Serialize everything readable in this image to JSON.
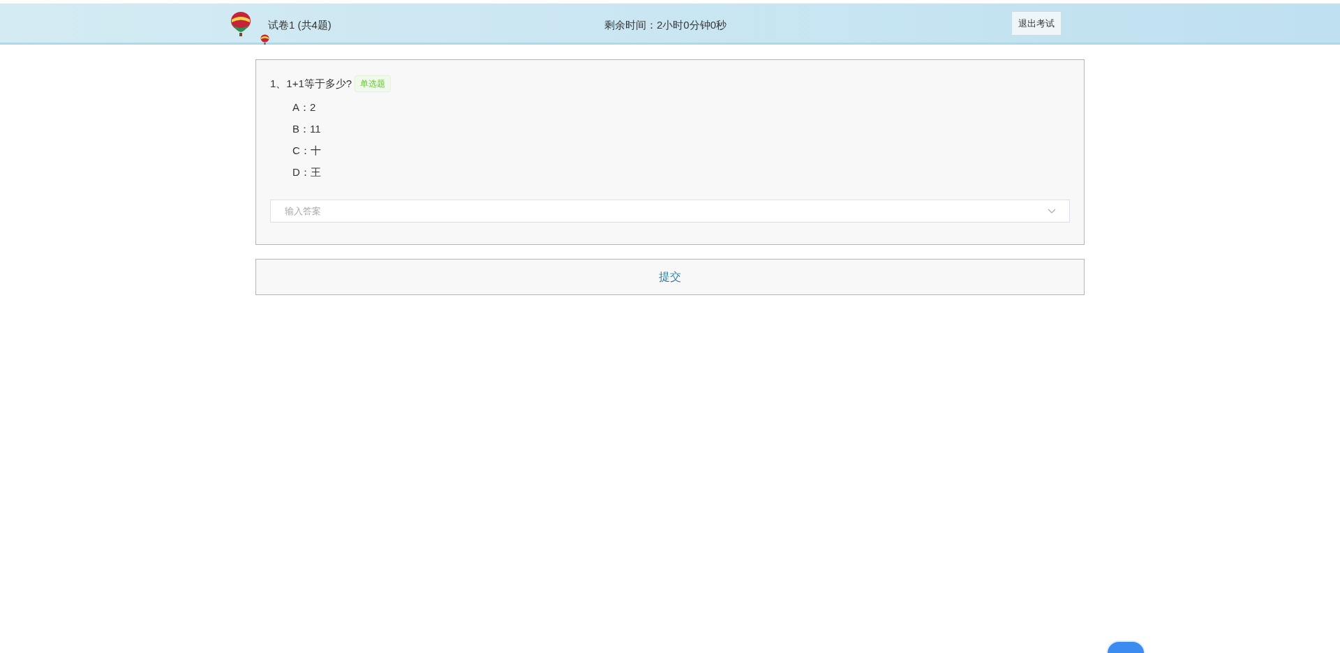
{
  "header": {
    "title": "试卷1 (共4题)",
    "timer": "剩余时间：2小时0分钟0秒",
    "exit_button": "退出考试"
  },
  "questions": [
    {
      "text": "1、1+1等于多少?",
      "type_tag": "单选题",
      "options": [
        {
          "label": "A：2"
        },
        {
          "label": "B：11"
        },
        {
          "label": "C：十"
        },
        {
          "label": "D：王"
        }
      ],
      "answer": {
        "placeholder": "输入答案"
      }
    }
  ],
  "submit_button": "提交"
}
